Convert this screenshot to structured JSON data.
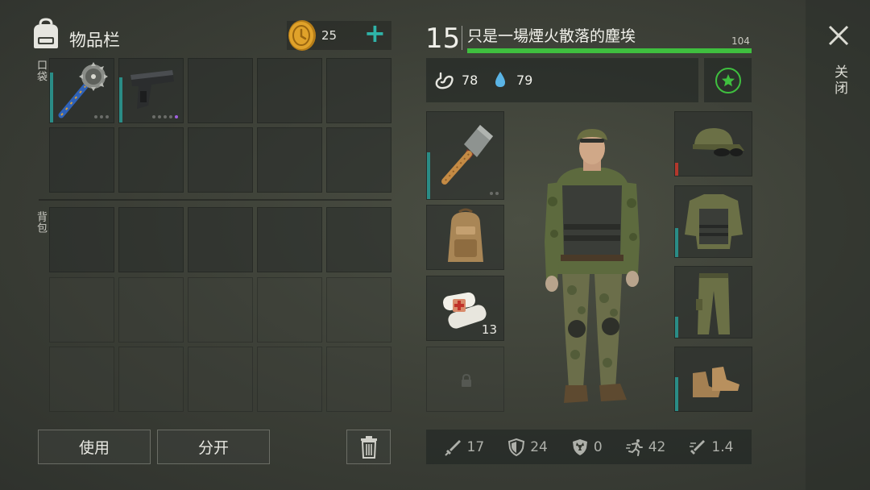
{
  "inventory": {
    "title": "物品栏",
    "coins": "25",
    "add_label": "+",
    "pocket_label": "口袋",
    "backpack_label": "背包",
    "use_label": "使用",
    "split_label": "分开"
  },
  "character": {
    "level": "15",
    "name": "只是一場煙火散落的塵埃",
    "xp_value": "104",
    "hunger": "78",
    "thirst": "79"
  },
  "equipment": {
    "bandage_count": "13"
  },
  "stats": {
    "attack": "17",
    "defense": "24",
    "radiation": "0",
    "speed": "42",
    "attack_speed": "1.4"
  },
  "close_label": "关闭",
  "colors": {
    "accent_teal": "#2a8c86",
    "xp_green": "#3fbf3f",
    "health_red": "#b3382c",
    "coin_gold": "#e0a22a"
  }
}
